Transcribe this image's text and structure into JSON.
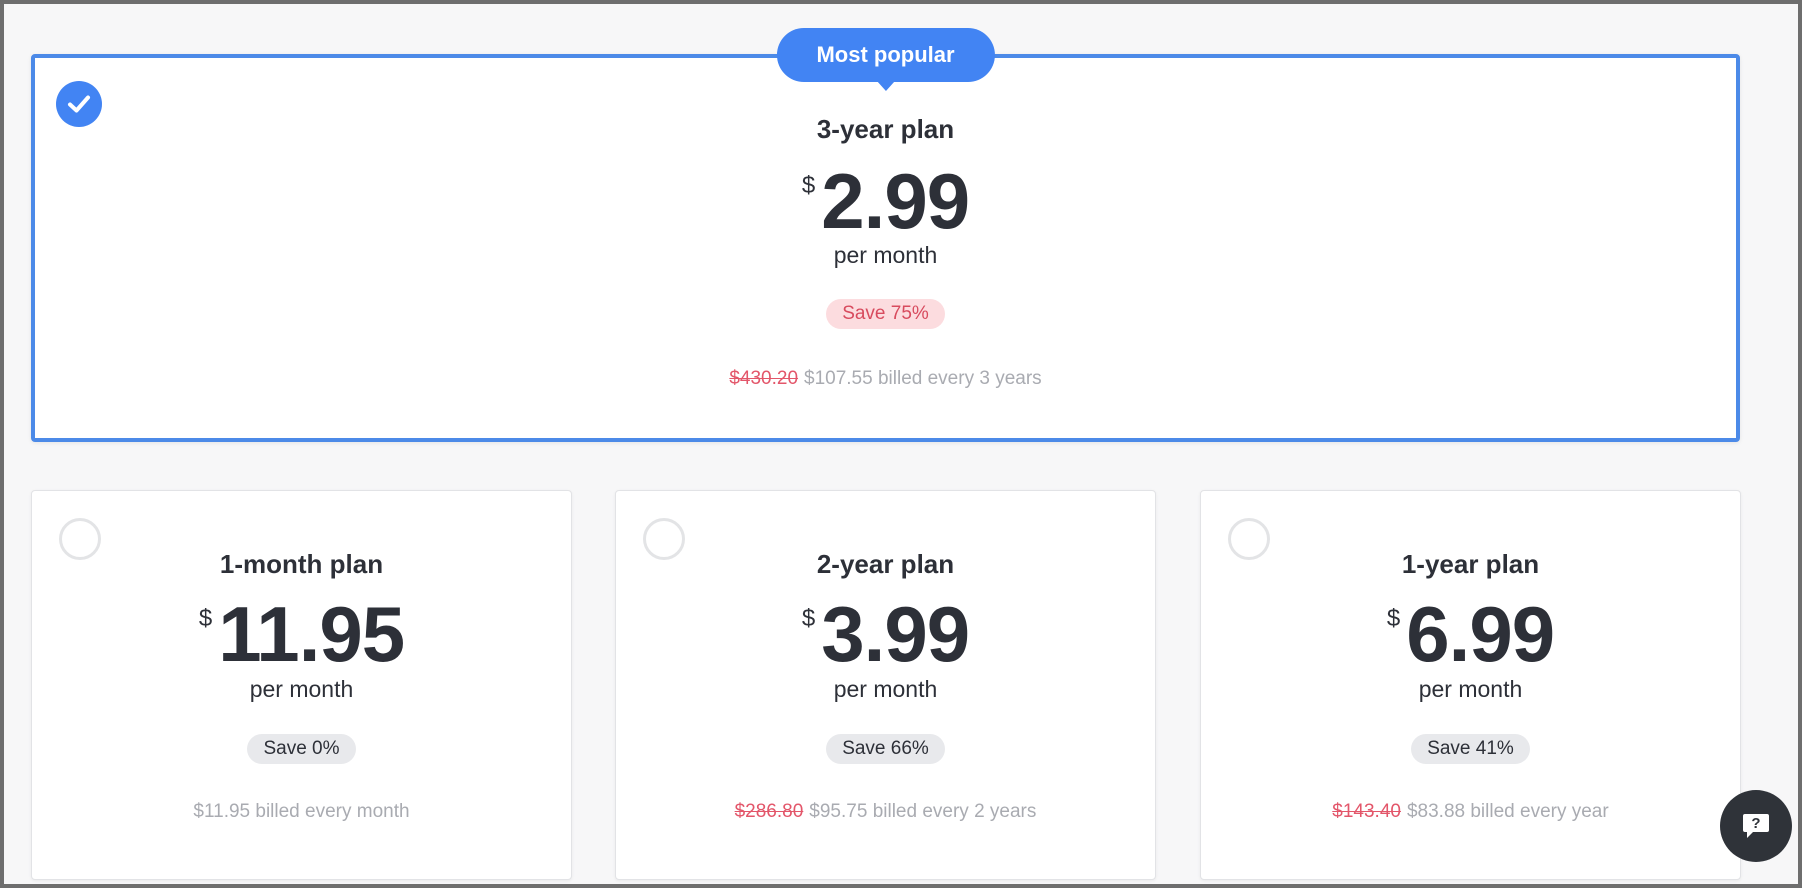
{
  "featured": {
    "ribbon": "Most popular",
    "plan_name": "3-year plan",
    "currency": "$",
    "amount": "2.99",
    "period": "per month",
    "save": "Save 75%",
    "old_price": "$430.20",
    "billing": "$107.55 billed every 3 years",
    "selected": true
  },
  "plans": [
    {
      "plan_name": "1-month plan",
      "currency": "$",
      "amount": "11.95",
      "period": "per month",
      "save": "Save 0%",
      "old_price": "",
      "billing": "$11.95 billed every month",
      "selected": false
    },
    {
      "plan_name": "2-year plan",
      "currency": "$",
      "amount": "3.99",
      "period": "per month",
      "save": "Save 66%",
      "old_price": "$286.80",
      "billing": "$95.75 billed every 2 years",
      "selected": false
    },
    {
      "plan_name": "1-year plan",
      "currency": "$",
      "amount": "6.99",
      "period": "per month",
      "save": "Save 41%",
      "old_price": "$143.40",
      "billing": "$83.88 billed every year",
      "selected": false
    }
  ],
  "chat": {
    "icon": "chat-help-icon",
    "glyph": "?"
  },
  "colors": {
    "accent": "#4284f3",
    "save_badge_bg": "#fcdcdf",
    "save_badge_text": "#d84b5e",
    "strike_price": "#e3566a",
    "billing_text": "#a9abb1",
    "dark_text": "#2d3038"
  }
}
